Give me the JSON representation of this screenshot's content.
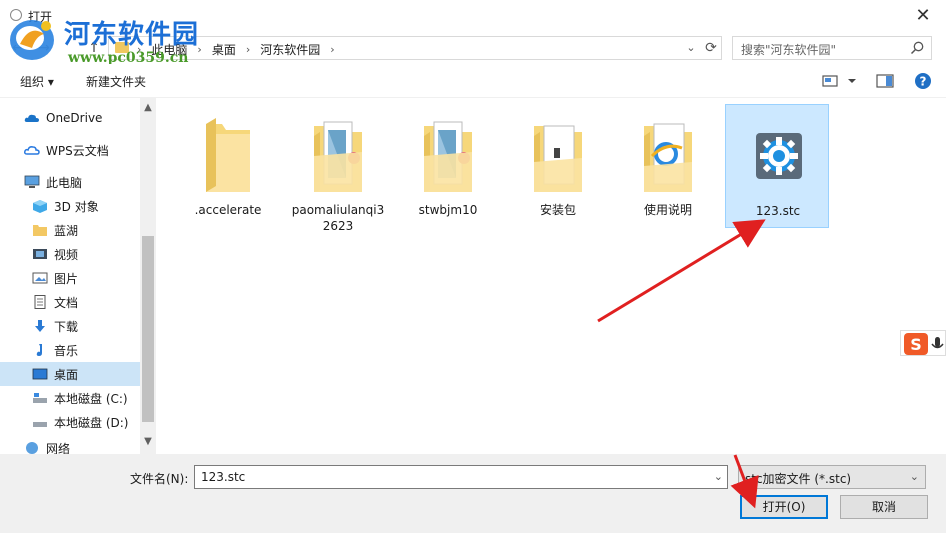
{
  "window": {
    "title": "打开",
    "close_glyph": "✕"
  },
  "watermark": {
    "site_name": "河东软件园",
    "url": "www.pc0359.cn"
  },
  "navigation": {
    "back_glyph": "←",
    "forward_glyph": "→",
    "up_glyph": "↑",
    "breadcrumbs": [
      "此电脑",
      "桌面",
      "河东软件园"
    ],
    "separator": "›",
    "dropdown_glyph": "⌄",
    "refresh_glyph": "⟳"
  },
  "search": {
    "placeholder": "搜索\"河东软件园\""
  },
  "toolbar": {
    "organize_label": "组织 ▾",
    "new_folder_label": "新建文件夹"
  },
  "sidebar": {
    "items": [
      {
        "label": "OneDrive",
        "icon": "cloud-icon"
      },
      {
        "label": "WPS云文档",
        "icon": "wps-cloud-icon"
      },
      {
        "label": "此电脑",
        "icon": "computer-icon"
      },
      {
        "label": "3D 对象",
        "icon": "3d-objects-icon"
      },
      {
        "label": "蓝湖",
        "icon": "folder-icon"
      },
      {
        "label": "视频",
        "icon": "video-icon"
      },
      {
        "label": "图片",
        "icon": "pictures-icon"
      },
      {
        "label": "文档",
        "icon": "documents-icon"
      },
      {
        "label": "下载",
        "icon": "download-icon"
      },
      {
        "label": "音乐",
        "icon": "music-icon"
      },
      {
        "label": "桌面",
        "icon": "desktop-icon",
        "selected": true
      },
      {
        "label": "本地磁盘 (C:)",
        "icon": "drive-icon"
      },
      {
        "label": "本地磁盘 (D:)",
        "icon": "drive-icon"
      },
      {
        "label": "网络",
        "icon": "network-icon"
      }
    ]
  },
  "files": [
    {
      "name": ".accelerate",
      "type": "folder-empty"
    },
    {
      "name": "paomaliulanqi32623",
      "type": "folder-docs"
    },
    {
      "name": "stwbjm10",
      "type": "folder-docs"
    },
    {
      "name": "安装包",
      "type": "folder-package"
    },
    {
      "name": "使用说明",
      "type": "folder-ie"
    },
    {
      "name": "123.stc",
      "type": "stc-file",
      "selected": true
    }
  ],
  "footer": {
    "filename_label": "文件名(N):",
    "filename_value": "123.stc",
    "filetype_value": "stc加密文件 (*.stc)",
    "open_button": "打开(O)",
    "cancel_button": "取消"
  },
  "colors": {
    "accent": "#0078d7",
    "selection": "#cce8ff",
    "arrow": "#e02020",
    "folder": "#f6d77a"
  }
}
